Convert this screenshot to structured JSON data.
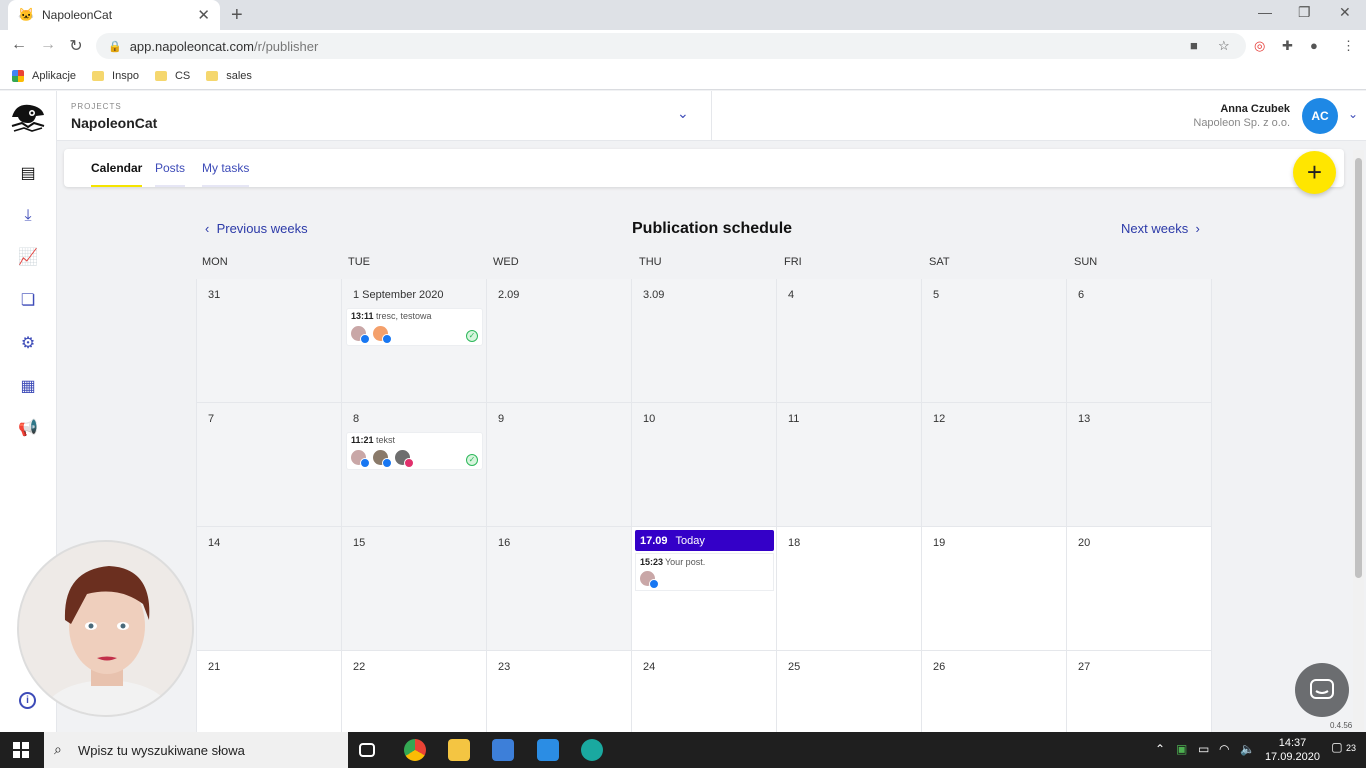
{
  "browser": {
    "tab_title": "NapoleonCat",
    "url_host": "app.napoleoncat.com",
    "url_path": "/r/publisher",
    "bookmarks": [
      {
        "label": "Aplikacje"
      },
      {
        "label": "Inspo"
      },
      {
        "label": "CS"
      },
      {
        "label": "sales"
      }
    ]
  },
  "header": {
    "projects_label": "PROJECTS",
    "project_name": "NapoleonCat",
    "user_name": "Anna Czubek",
    "user_company": "Napoleon Sp. z o.o.",
    "user_initials": "AC"
  },
  "tabs": [
    {
      "label": "Calendar",
      "active": true
    },
    {
      "label": "Posts",
      "active": false
    },
    {
      "label": "My tasks",
      "active": false
    }
  ],
  "calendar": {
    "title": "Publication schedule",
    "prev_label": "Previous weeks",
    "next_label": "Next weeks",
    "weekdays": [
      "MON",
      "TUE",
      "WED",
      "THU",
      "FRI",
      "SAT",
      "SUN"
    ],
    "weeks": [
      [
        "31",
        "1 September 2020",
        "2.09",
        "3.09",
        "4",
        "5",
        "6"
      ],
      [
        "7",
        "8",
        "9",
        "10",
        "11",
        "12",
        "13"
      ],
      [
        "14",
        "15",
        "16",
        "",
        "18",
        "19",
        "20"
      ],
      [
        "21",
        "22",
        "23",
        "24",
        "25",
        "26",
        "27"
      ]
    ],
    "posts": [
      {
        "time": "13:11",
        "text": "tresc, testowa"
      },
      {
        "time": "11:21",
        "text": "tekst"
      },
      {
        "time": "15:23",
        "text": "Your post."
      }
    ],
    "today_date": "17.09",
    "today_label": "Today"
  },
  "version": "0.4.56",
  "taskbar": {
    "search_placeholder": "Wpisz tu wyszukiwane słowa",
    "time": "14:37",
    "date": "17.09.2020",
    "notifications": "23"
  },
  "colors": {
    "accent": "#3d4bb8",
    "today": "#3400c8",
    "fab": "#ffe600",
    "avatar": "#1e88e5",
    "facebook": "#1877f2",
    "instagram": "#e1306c"
  }
}
